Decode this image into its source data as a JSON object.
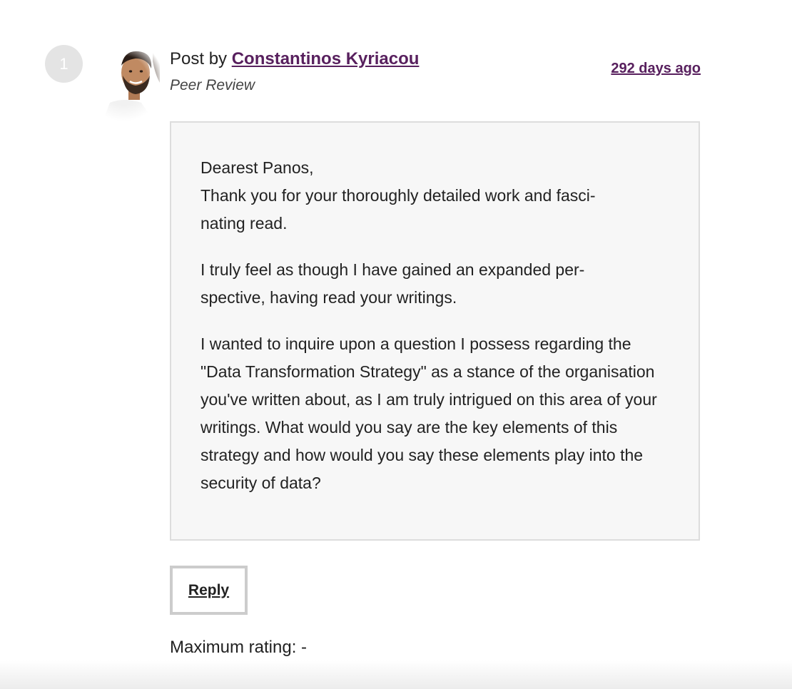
{
  "post": {
    "number": "1",
    "prefix": "Post by ",
    "author": "Constantinos Kyriacou",
    "role": "Peer Review",
    "time_ago": "292 days ago",
    "avatar_icon": "user-avatar-photo"
  },
  "message": {
    "paragraph_1_line_1": "Dearest Panos,",
    "paragraph_1_line_2": "Thank you for your thoroughly detailed work and fasci-nating read.",
    "paragraph_2": "I truly feel as though I have gained an expanded per-spective, having read your writings.",
    "paragraph_3": "I wanted to inquire upon a question I possess regarding the \"Data Transformation Strategy\" as a stance of the organisation you've written about, as I am truly intrigued on this area of your writings. What would you say are the key elements of this strategy and how would you say these elements play into the security of data?"
  },
  "actions": {
    "reply_label": "Reply"
  },
  "rating": {
    "text": "Maximum rating: -"
  },
  "colors": {
    "link": "#58205e",
    "box_background": "#f7f7f7",
    "box_border": "#dddddd",
    "number_badge": "#e4e4e4"
  }
}
